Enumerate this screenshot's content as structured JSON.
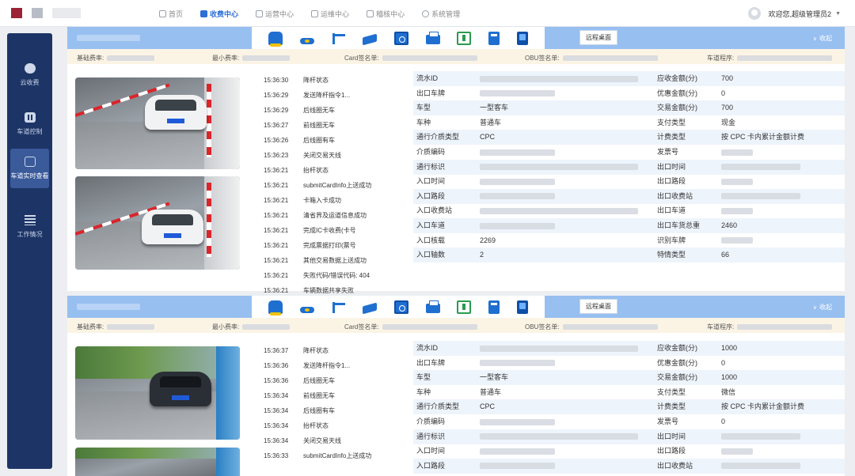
{
  "nav": {
    "items": [
      {
        "label": "首页",
        "active": false
      },
      {
        "label": "收费中心",
        "active": true
      },
      {
        "label": "运营中心",
        "active": false
      },
      {
        "label": "运维中心",
        "active": false
      },
      {
        "label": "稽核中心",
        "active": false
      },
      {
        "label": "系统管理",
        "active": false
      }
    ],
    "user_greeting": "欢迎您,超级管理员2"
  },
  "sidebar": {
    "items": [
      {
        "label": "云收费",
        "icon": "cloud-icon",
        "active": false
      },
      {
        "label": "车道控制",
        "icon": "lane-control-icon",
        "active": false
      },
      {
        "label": "车道实时查看",
        "icon": "lane-monitor-icon",
        "active": true
      },
      {
        "label": "工作情况",
        "icon": "work-status-icon",
        "active": false
      }
    ]
  },
  "panel_common": {
    "remote_button": "远程桌面",
    "collapse_label": "收起",
    "info_labels": [
      "基础费率:",
      "最小费率:",
      "Card签名单:",
      "OBU签名单:",
      "车道程序:"
    ]
  },
  "lanes": [
    {
      "log": [
        {
          "time": "15:36:30",
          "msg": "降杆状态"
        },
        {
          "time": "15:36:29",
          "msg": "发送降杆指令1..."
        },
        {
          "time": "15:36:29",
          "msg": "后线圈无车"
        },
        {
          "time": "15:36:27",
          "msg": "前线圈无车"
        },
        {
          "time": "15:36:26",
          "msg": "后线圈有车"
        },
        {
          "time": "15:36:23",
          "msg": "关闭交易天线"
        },
        {
          "time": "15:36:21",
          "msg": "抬杆状态"
        },
        {
          "time": "15:36:21",
          "msg": "submitCardInfo上送成功"
        },
        {
          "time": "15:36:21",
          "msg": "卡箱入卡成功"
        },
        {
          "time": "15:36:21",
          "msg": "清省界及运道信息成功"
        },
        {
          "time": "15:36:21",
          "msg": "完成IC卡收费(卡号"
        },
        {
          "time": "15:36:21",
          "msg": "完成票据打印(票号"
        },
        {
          "time": "15:36:21",
          "msg": "其他交易数据上送成功"
        },
        {
          "time": "15:36:21",
          "msg": "失败代码/错误代码: 404"
        },
        {
          "time": "15:36:21",
          "msg": "车辆数据共享失败"
        }
      ],
      "details": [
        {
          "k": "流水ID",
          "v": "",
          "k2": "应收金额(分)",
          "v2": "700"
        },
        {
          "k": "出口车牌",
          "v": "",
          "k2": "优惠金额(分)",
          "v2": "0"
        },
        {
          "k": "车型",
          "v": "一型客车",
          "k2": "交易金额(分)",
          "v2": "700"
        },
        {
          "k": "车种",
          "v": "普通车",
          "k2": "支付类型",
          "v2": "现金"
        },
        {
          "k": "通行介质类型",
          "v": "CPC",
          "k2": "计费类型",
          "v2": "按 CPC 卡内累计金额计费"
        },
        {
          "k": "介质编码",
          "v": "",
          "k2": "发票号",
          "v2": ""
        },
        {
          "k": "通行标识",
          "v": "",
          "k2": "出口时间",
          "v2": ""
        },
        {
          "k": "入口时间",
          "v": "",
          "k2": "出口路段",
          "v2": ""
        },
        {
          "k": "入口路段",
          "v": "",
          "k2": "出口收费站",
          "v2": ""
        },
        {
          "k": "入口收费站",
          "v": "",
          "k2": "出口车道",
          "v2": ""
        },
        {
          "k": "入口车道",
          "v": "",
          "k2": "出口车货总重",
          "v2": "2460"
        },
        {
          "k": "入口核载",
          "v": "2269",
          "k2": "识别车牌",
          "v2": ""
        },
        {
          "k": "入口轴数",
          "v": "2",
          "k2": "特情类型",
          "v2": "66"
        }
      ]
    },
    {
      "log": [
        {
          "time": "15:36:37",
          "msg": "降杆状态"
        },
        {
          "time": "15:36:36",
          "msg": "发送降杆指令1..."
        },
        {
          "time": "15:36:36",
          "msg": "后线圈无车"
        },
        {
          "time": "15:36:34",
          "msg": "前线圈无车"
        },
        {
          "time": "15:36:34",
          "msg": "后线圈有车"
        },
        {
          "time": "15:36:34",
          "msg": "抬杆状态"
        },
        {
          "time": "15:36:34",
          "msg": "关闭交易天线"
        },
        {
          "time": "15:36:33",
          "msg": "submitCardInfo上送成功"
        }
      ],
      "details": [
        {
          "k": "流水ID",
          "v": "",
          "k2": "应收金额(分)",
          "v2": "1000"
        },
        {
          "k": "出口车牌",
          "v": "",
          "k2": "优惠金额(分)",
          "v2": "0"
        },
        {
          "k": "车型",
          "v": "一型客车",
          "k2": "交易金额(分)",
          "v2": "1000"
        },
        {
          "k": "车种",
          "v": "普通车",
          "k2": "支付类型",
          "v2": "微信"
        },
        {
          "k": "通行介质类型",
          "v": "CPC",
          "k2": "计费类型",
          "v2": "按 CPC 卡内累计金额计费"
        },
        {
          "k": "介质编码",
          "v": "",
          "k2": "发票号",
          "v2": "0"
        },
        {
          "k": "通行标识",
          "v": "",
          "k2": "出口时间",
          "v2": ""
        },
        {
          "k": "入口时间",
          "v": "",
          "k2": "出口路段",
          "v2": ""
        },
        {
          "k": "入口路段",
          "v": "",
          "k2": "出口收费站",
          "v2": ""
        }
      ]
    }
  ]
}
